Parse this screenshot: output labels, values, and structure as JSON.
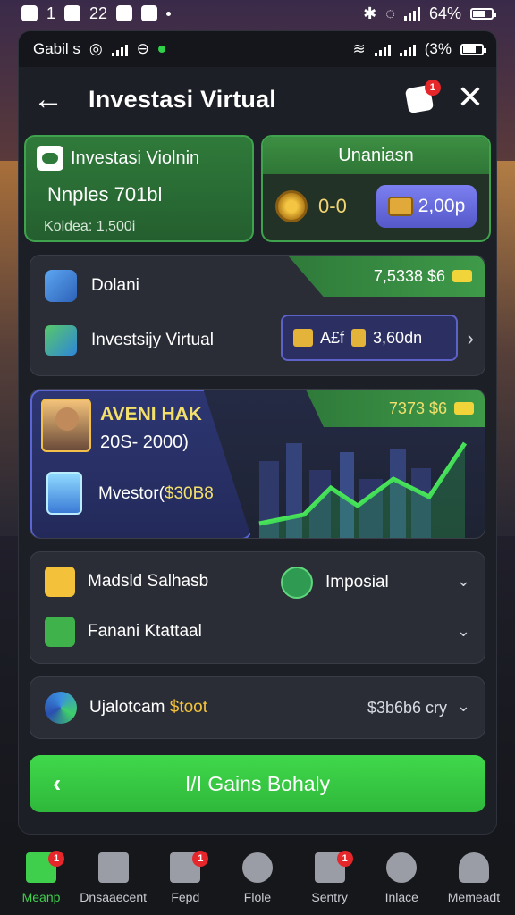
{
  "status_bar": {
    "left_text": "1",
    "left_text2": "22",
    "battery": "64%"
  },
  "inner_status": {
    "carrier": "Gabil s",
    "battery": "(3%"
  },
  "header": {
    "title": "Investasi Virtual",
    "notification_count": "1"
  },
  "card_investasi": {
    "title": "Investasi Violnin",
    "name": "Nnples 701bl",
    "subtitle": "Koldea: 1,500i"
  },
  "card_unaniasn": {
    "title": "Unaniasn",
    "coin_value": "0-0",
    "button_value": "2,00p"
  },
  "balance": {
    "ribbon_value": "7,5338 $6",
    "row1_label": "Dolani",
    "row2_label": "Investsijy Virtual",
    "pill_text1": "A£f",
    "pill_text2": "3,60dn"
  },
  "market": {
    "name": "AVENI HAK",
    "years": "20S- 2000)",
    "investor_label": "Mvestor(",
    "investor_value": "$30B8",
    "ribbon_value": "7373 $6"
  },
  "options": {
    "opt1": "Madsld Salhasb",
    "opt2": "Imposial",
    "opt3": "Fanani Ktattaal"
  },
  "tech": {
    "label": "Ujalotcam",
    "label_accent": "$toot",
    "value": "$3b6b6 cry"
  },
  "cta": {
    "label": "I/I Gains Bohaly"
  },
  "nav": {
    "items": [
      {
        "label": "Meanp",
        "badge": "1"
      },
      {
        "label": "Dnsaaecent",
        "badge": ""
      },
      {
        "label": "Fepd",
        "badge": "1"
      },
      {
        "label": "Flole",
        "badge": ""
      },
      {
        "label": "Sentry",
        "badge": "1"
      },
      {
        "label": "Inlace",
        "badge": ""
      },
      {
        "label": "Memeadt",
        "badge": ""
      }
    ]
  },
  "colors": {
    "accent_green": "#3fcf4c",
    "purple": "#5c62c8",
    "gold": "#f3e06b",
    "badge_red": "#e5262b"
  }
}
